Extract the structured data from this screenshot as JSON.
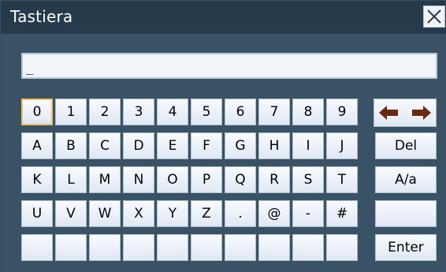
{
  "window": {
    "title": "Tastiera"
  },
  "input": {
    "value": "_"
  },
  "keys": {
    "row1": [
      "0",
      "1",
      "2",
      "3",
      "4",
      "5",
      "6",
      "7",
      "8",
      "9"
    ],
    "row2": [
      "A",
      "B",
      "C",
      "D",
      "E",
      "F",
      "G",
      "H",
      "I",
      "J"
    ],
    "row3": [
      "K",
      "L",
      "M",
      "N",
      "O",
      "P",
      "Q",
      "R",
      "S",
      "T"
    ],
    "row4": [
      "U",
      "V",
      "W",
      "X",
      "Y",
      "Z",
      ".",
      "@",
      "-",
      "#"
    ],
    "row5": [
      "",
      "",
      "",
      "",
      "",
      "",
      "",
      "",
      "",
      ""
    ]
  },
  "side": {
    "del": "Del",
    "case": "A/a",
    "blank": "",
    "enter": "Enter"
  },
  "icons": {
    "close": "close-icon",
    "left": "left-arrow-icon",
    "right": "right-arrow-icon"
  },
  "colors": {
    "accent": "#f0c060",
    "arrow": "#6a2a10"
  }
}
